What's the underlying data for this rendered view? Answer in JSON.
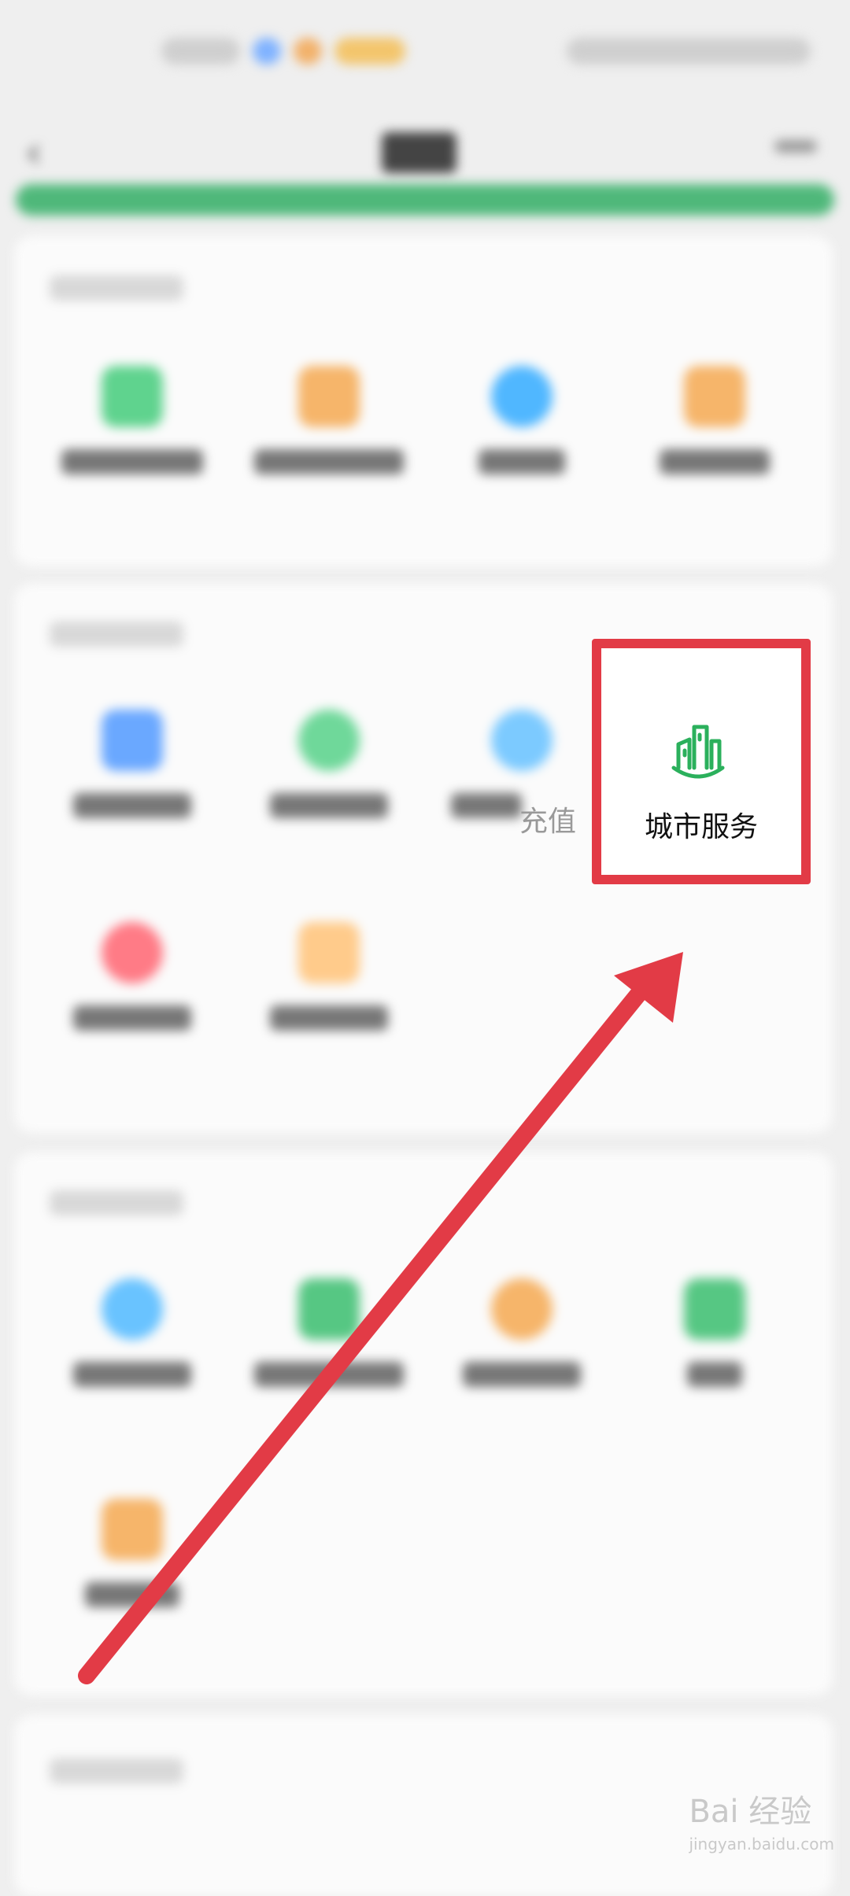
{
  "highlighted_item": {
    "label": "城市服务",
    "icon": "city-building-icon"
  },
  "partial_label": "充值",
  "watermark": {
    "text": "Bai 经验",
    "sub": "jingyan.baidu.com"
  },
  "colors": {
    "accent_green": "#2bb05c",
    "annotation_red": "#e23b46",
    "progress_green": "#4fb87a"
  }
}
